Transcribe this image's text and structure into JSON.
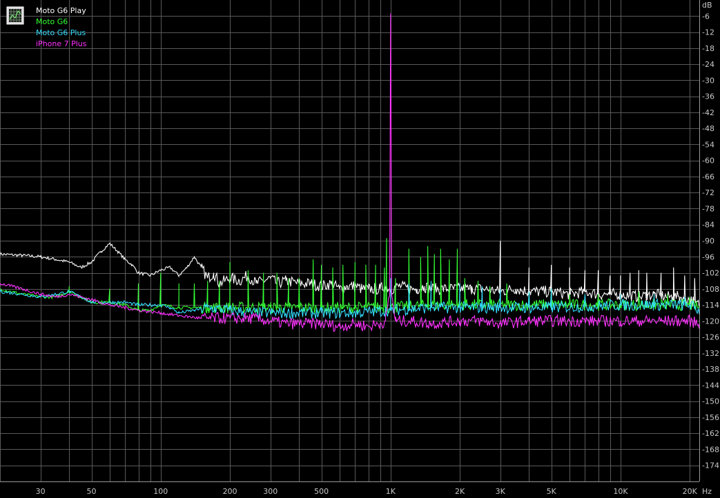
{
  "chart_data": {
    "type": "line",
    "xscale": "log",
    "xlim": [
      20,
      22000
    ],
    "ylim": [
      -180,
      0
    ],
    "grid": true,
    "legend_position": "top-left",
    "ylabel": "dB",
    "xlabel": "Hz",
    "colors": {
      "background": "#000000",
      "grid": "#5a5a5a",
      "axis_text": "#c8c8c8"
    },
    "x_ticks": [
      {
        "v": 30,
        "t": "30"
      },
      {
        "v": 50,
        "t": "50"
      },
      {
        "v": 100,
        "t": "100"
      },
      {
        "v": 200,
        "t": "200"
      },
      {
        "v": 300,
        "t": "300"
      },
      {
        "v": 500,
        "t": "500"
      },
      {
        "v": 1000,
        "t": "1K"
      },
      {
        "v": 2000,
        "t": "2K"
      },
      {
        "v": 3000,
        "t": "3K"
      },
      {
        "v": 5000,
        "t": "5K"
      },
      {
        "v": 10000,
        "t": "10K"
      },
      {
        "v": 20000,
        "t": "20K"
      }
    ],
    "y_ticks": [
      -6,
      -12,
      -18,
      -24,
      -30,
      -36,
      -42,
      -48,
      -54,
      -60,
      -66,
      -72,
      -78,
      -84,
      -90,
      -96,
      -102,
      -108,
      -114,
      -120,
      -126,
      -132,
      -138,
      -144,
      -150,
      -156,
      -162,
      -168,
      -174
    ],
    "series": [
      {
        "name": "Moto G6 Play",
        "color": "#ffffff",
        "x": [
          20,
          25,
          30,
          35,
          40,
          45,
          50,
          55,
          60,
          65,
          70,
          75,
          80,
          90,
          100,
          110,
          120,
          130,
          140,
          150,
          160,
          170,
          180,
          200,
          220,
          240,
          260,
          280,
          300,
          320,
          350,
          400,
          450,
          500,
          550,
          600,
          650,
          700,
          750,
          800,
          850,
          900,
          950,
          1000,
          1100,
          1200,
          1300,
          1400,
          1500,
          1700,
          2000,
          2200,
          2500,
          3000,
          3500,
          4000,
          5000,
          6000,
          7000,
          8000,
          9000,
          10000,
          12000,
          14000,
          16000,
          18000,
          20000,
          22000
        ],
        "y": [
          -95,
          -95.5,
          -96,
          -97,
          -98,
          -100,
          -98,
          -94,
          -91,
          -94,
          -97,
          -99,
          -102,
          -103,
          -101,
          -100,
          -103,
          -100,
          -96,
          -100,
          -104,
          -102,
          -106,
          -104,
          -105,
          -103,
          -106,
          -105,
          -104,
          -106,
          -105,
          -106,
          -106,
          -107,
          -106,
          -108,
          -107,
          -107,
          -108,
          -108,
          -108,
          -108,
          -107,
          -108,
          -107,
          -108,
          -108,
          -107,
          -108,
          -108,
          -108,
          -108,
          -108,
          -109,
          -108,
          -109,
          -109,
          -110,
          -109,
          -110,
          -110,
          -110,
          -111,
          -110,
          -111,
          -111,
          -112,
          -114
        ],
        "spikes": [
          {
            "x": 2250,
            "y": -107
          },
          {
            "x": 3000,
            "y": -90
          },
          {
            "x": 4000,
            "y": -100
          },
          {
            "x": 5000,
            "y": -99
          },
          {
            "x": 6000,
            "y": -100
          },
          {
            "x": 7000,
            "y": -101
          },
          {
            "x": 8000,
            "y": -101
          },
          {
            "x": 9000,
            "y": -103
          },
          {
            "x": 10000,
            "y": -103
          },
          {
            "x": 11000,
            "y": -102
          },
          {
            "x": 12000,
            "y": -101
          },
          {
            "x": 13000,
            "y": -102
          },
          {
            "x": 15000,
            "y": -102
          },
          {
            "x": 17000,
            "y": -100
          },
          {
            "x": 19000,
            "y": -103
          },
          {
            "x": 21000,
            "y": -104
          }
        ]
      },
      {
        "name": "Moto G6",
        "color": "#33ff33",
        "x": [
          20,
          25,
          30,
          35,
          40,
          45,
          50,
          55,
          60,
          70,
          80,
          90,
          100,
          120,
          150,
          200,
          300,
          500,
          700,
          1000,
          1500,
          2000,
          3000,
          5000,
          10000,
          15000,
          20000,
          22000
        ],
        "y": [
          -108,
          -110,
          -111,
          -111,
          -109,
          -111,
          -113,
          -113,
          -113,
          -114,
          -116,
          -116,
          -114,
          -115,
          -115,
          -115,
          -115,
          -115,
          -115,
          -115,
          -114,
          -114,
          -114,
          -114,
          -114,
          -114,
          -114,
          -115
        ],
        "spikes": [
          {
            "x": 40,
            "y": -107
          },
          {
            "x": 60,
            "y": -108
          },
          {
            "x": 80,
            "y": -106
          },
          {
            "x": 100,
            "y": -102
          },
          {
            "x": 120,
            "y": -106
          },
          {
            "x": 140,
            "y": -106
          },
          {
            "x": 160,
            "y": -105
          },
          {
            "x": 180,
            "y": -105
          },
          {
            "x": 200,
            "y": -98
          },
          {
            "x": 240,
            "y": -101
          },
          {
            "x": 280,
            "y": -102
          },
          {
            "x": 320,
            "y": -102
          },
          {
            "x": 360,
            "y": -104
          },
          {
            "x": 400,
            "y": -104
          },
          {
            "x": 460,
            "y": -97
          },
          {
            "x": 500,
            "y": -99
          },
          {
            "x": 560,
            "y": -100
          },
          {
            "x": 620,
            "y": -99
          },
          {
            "x": 700,
            "y": -98
          },
          {
            "x": 780,
            "y": -99
          },
          {
            "x": 860,
            "y": -99
          },
          {
            "x": 940,
            "y": -100
          },
          {
            "x": 960,
            "y": -89
          },
          {
            "x": 1050,
            "y": -104
          },
          {
            "x": 1200,
            "y": -93
          },
          {
            "x": 1350,
            "y": -96
          },
          {
            "x": 1450,
            "y": -92
          },
          {
            "x": 1550,
            "y": -95
          },
          {
            "x": 1650,
            "y": -93
          },
          {
            "x": 1800,
            "y": -97
          },
          {
            "x": 1950,
            "y": -93
          },
          {
            "x": 2100,
            "y": -104
          },
          {
            "x": 2400,
            "y": -105
          },
          {
            "x": 2700,
            "y": -107
          },
          {
            "x": 3200,
            "y": -106
          },
          {
            "x": 4000,
            "y": -109
          },
          {
            "x": 5000,
            "y": -108
          },
          {
            "x": 6000,
            "y": -110
          },
          {
            "x": 8000,
            "y": -110
          },
          {
            "x": 10000,
            "y": -111
          },
          {
            "x": 12000,
            "y": -109
          },
          {
            "x": 16000,
            "y": -110
          },
          {
            "x": 20000,
            "y": -111
          }
        ]
      },
      {
        "name": "Moto G6 Plus",
        "color": "#33ddff",
        "x": [
          20,
          25,
          30,
          35,
          40,
          45,
          50,
          60,
          70,
          80,
          90,
          100,
          110,
          120,
          140,
          160,
          200,
          250,
          300,
          400,
          500,
          700,
          1000,
          1500,
          2000,
          3000,
          5000,
          10000,
          15000,
          20000,
          22000
        ],
        "y": [
          -109,
          -110,
          -111,
          -110,
          -109,
          -111,
          -113,
          -113,
          -113,
          -114,
          -114,
          -114,
          -115,
          -117,
          -116,
          -115,
          -116,
          -117,
          -117,
          -117,
          -117,
          -117,
          -116,
          -115,
          -115,
          -115,
          -115,
          -114,
          -114,
          -114,
          -116
        ],
        "spikes": [
          {
            "x": 1000,
            "y": -104
          },
          {
            "x": 1200,
            "y": -106
          },
          {
            "x": 1500,
            "y": -105
          },
          {
            "x": 2000,
            "y": -106
          },
          {
            "x": 2500,
            "y": -107
          },
          {
            "x": 3000,
            "y": -108
          },
          {
            "x": 4000,
            "y": -109
          },
          {
            "x": 5000,
            "y": -108
          },
          {
            "x": 7000,
            "y": -110
          },
          {
            "x": 10000,
            "y": -110
          },
          {
            "x": 14000,
            "y": -110
          },
          {
            "x": 19000,
            "y": -111
          }
        ]
      },
      {
        "name": "iPhone 7 Plus",
        "color": "#ff33ff",
        "x": [
          20,
          25,
          30,
          35,
          40,
          50,
          60,
          70,
          80,
          100,
          120,
          150,
          200,
          250,
          300,
          350,
          400,
          500,
          600,
          700,
          800,
          900,
          950,
          990,
          1000,
          1010,
          1050,
          1100,
          1200,
          1500,
          2000,
          2500,
          3000,
          4000,
          5000,
          7000,
          10000,
          15000,
          20000,
          22000
        ],
        "y": [
          -106,
          -108,
          -110,
          -111,
          -110,
          -112,
          -114,
          -115,
          -116,
          -117,
          -118,
          -119,
          -119,
          -119,
          -120,
          -121,
          -121,
          -121,
          -122,
          -121,
          -122,
          -121,
          -120,
          -110,
          -5,
          -110,
          -120,
          -120,
          -120,
          -121,
          -120,
          -120,
          -121,
          -120,
          -120,
          -120,
          -120,
          -120,
          -120,
          -121
        ],
        "spikes": []
      }
    ]
  },
  "legend": [
    {
      "label": "Moto G6 Play",
      "color": "#ffffff"
    },
    {
      "label": "Moto G6",
      "color": "#33ff33"
    },
    {
      "label": "Moto G6 Plus",
      "color": "#33ddff"
    },
    {
      "label": "iPhone 7 Plus",
      "color": "#ff33ff"
    }
  ]
}
